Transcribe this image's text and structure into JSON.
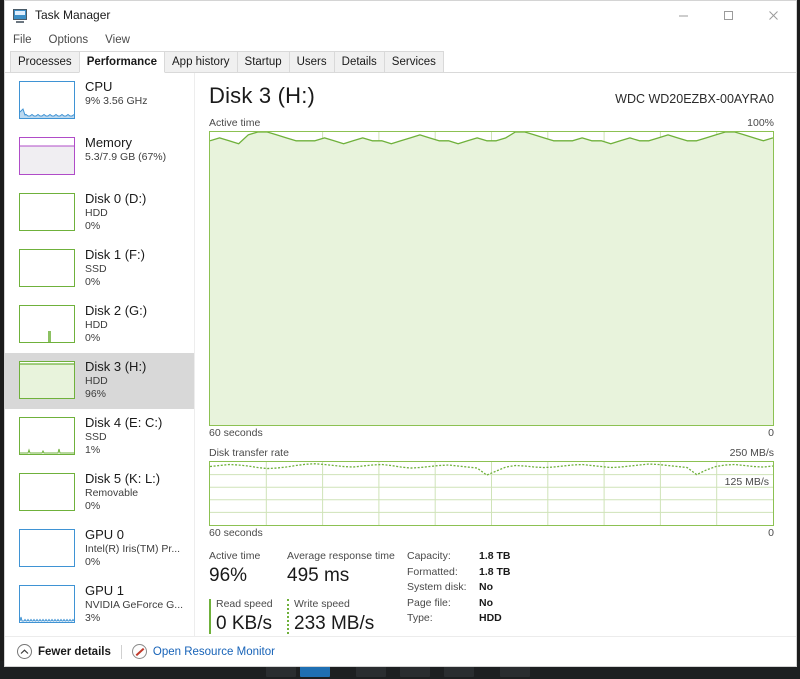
{
  "window": {
    "title": "Task Manager",
    "icon": "task-manager-icon",
    "controls": {
      "minimize": "minimize-icon",
      "maximize": "maximize-icon",
      "close": "close-icon"
    }
  },
  "menu": {
    "items": [
      "File",
      "Options",
      "View"
    ]
  },
  "tabs": {
    "active": "Performance",
    "items": [
      "Processes",
      "Performance",
      "App history",
      "Startup",
      "Users",
      "Details",
      "Services"
    ]
  },
  "sidebar": {
    "items": [
      {
        "title": "CPU",
        "sub": "",
        "value": "9%  3.56 GHz",
        "accent": "#3f93d4",
        "kind": "cpu",
        "selected": false
      },
      {
        "title": "Memory",
        "sub": "",
        "value": "5.3/7.9 GB (67%)",
        "accent": "#b04cc8",
        "kind": "memory",
        "selected": false
      },
      {
        "title": "Disk 0 (D:)",
        "sub": "HDD",
        "value": "0%",
        "accent": "#6fb13b",
        "kind": "disk",
        "selected": false
      },
      {
        "title": "Disk 1 (F:)",
        "sub": "SSD",
        "value": "0%",
        "accent": "#6fb13b",
        "kind": "disk",
        "selected": false
      },
      {
        "title": "Disk 2 (G:)",
        "sub": "HDD",
        "value": "0%",
        "accent": "#6fb13b",
        "kind": "disk-spike",
        "selected": false
      },
      {
        "title": "Disk 3 (H:)",
        "sub": "HDD",
        "value": "96%",
        "accent": "#6fb13b",
        "kind": "disk-full",
        "selected": true
      },
      {
        "title": "Disk 4 (E: C:)",
        "sub": "SSD",
        "value": "1%",
        "accent": "#6fb13b",
        "kind": "disk-low",
        "selected": false
      },
      {
        "title": "Disk 5 (K: L:)",
        "sub": "Removable",
        "value": "0%",
        "accent": "#6fb13b",
        "kind": "disk",
        "selected": false
      },
      {
        "title": "GPU 0",
        "sub": "Intel(R) Iris(TM) Pr...",
        "value": "0%",
        "accent": "#3f93d4",
        "kind": "gpu",
        "selected": false
      },
      {
        "title": "GPU 1",
        "sub": "NVIDIA GeForce G...",
        "value": "3%",
        "accent": "#3f93d4",
        "kind": "gpu-low",
        "selected": false
      }
    ]
  },
  "main": {
    "title": "Disk 3 (H:)",
    "model": "WDC WD20EZBX-00AYRA0"
  },
  "chart_data": [
    {
      "type": "area",
      "title": "Active time",
      "ylabel_max": "100%",
      "ylabel_min": "0",
      "xlabel_left": "60 seconds",
      "xlabel_right": "0",
      "ylim": [
        0,
        100
      ],
      "grid": true,
      "grid_cols": 10,
      "grid_rows": 10,
      "line_color": "#6fb13b",
      "fill_color": "#e8f3dc",
      "values": [
        97,
        98,
        97,
        96,
        99,
        100,
        100,
        99,
        98,
        97,
        97,
        97,
        98,
        97,
        96,
        97,
        98,
        97,
        97,
        96,
        97,
        98,
        99,
        98,
        97,
        97,
        96,
        97,
        98,
        97,
        97,
        98,
        100,
        100,
        99,
        98,
        97,
        97,
        97,
        98,
        97,
        97,
        96,
        97,
        98,
        97,
        97,
        98,
        99,
        98,
        97,
        97,
        98,
        99,
        100,
        100,
        99,
        98,
        97,
        98
      ]
    },
    {
      "type": "line",
      "title": "Disk transfer rate",
      "ylabel_max": "250 MB/s",
      "ylabel_mid": "125 MB/s",
      "xlabel_left": "60 seconds",
      "xlabel_right": "0",
      "ylim": [
        0,
        250
      ],
      "grid": true,
      "grid_cols": 10,
      "grid_rows": 5,
      "line_color": "#6fb13b",
      "line_style": "dotted",
      "values": [
        232,
        236,
        240,
        238,
        234,
        228,
        224,
        226,
        230,
        236,
        241,
        243,
        240,
        236,
        232,
        230,
        234,
        238,
        240,
        236,
        230,
        226,
        228,
        232,
        236,
        238,
        234,
        230,
        226,
        198,
        214,
        230,
        236,
        234,
        230,
        228,
        230,
        234,
        238,
        240,
        236,
        232,
        228,
        230,
        234,
        238,
        242,
        240,
        236,
        232,
        228,
        200,
        218,
        232,
        238,
        240,
        236,
        232,
        230,
        234
      ]
    }
  ],
  "stats": {
    "active_time_label": "Active time",
    "active_time_value": "96%",
    "response_label": "Average response time",
    "response_value": "495 ms",
    "read_label": "Read speed",
    "read_value": "0 KB/s",
    "write_label": "Write speed",
    "write_value": "233 MB/s",
    "details": [
      {
        "key": "Capacity:",
        "value": "1.8 TB"
      },
      {
        "key": "Formatted:",
        "value": "1.8 TB"
      },
      {
        "key": "System disk:",
        "value": "No"
      },
      {
        "key": "Page file:",
        "value": "No"
      },
      {
        "key": "Type:",
        "value": "HDD"
      }
    ]
  },
  "statusbar": {
    "fewer_details": "Fewer details",
    "fewer_icon": "chevron-up-icon",
    "resource_monitor": "Open Resource Monitor",
    "resource_icon": "resource-monitor-icon"
  }
}
